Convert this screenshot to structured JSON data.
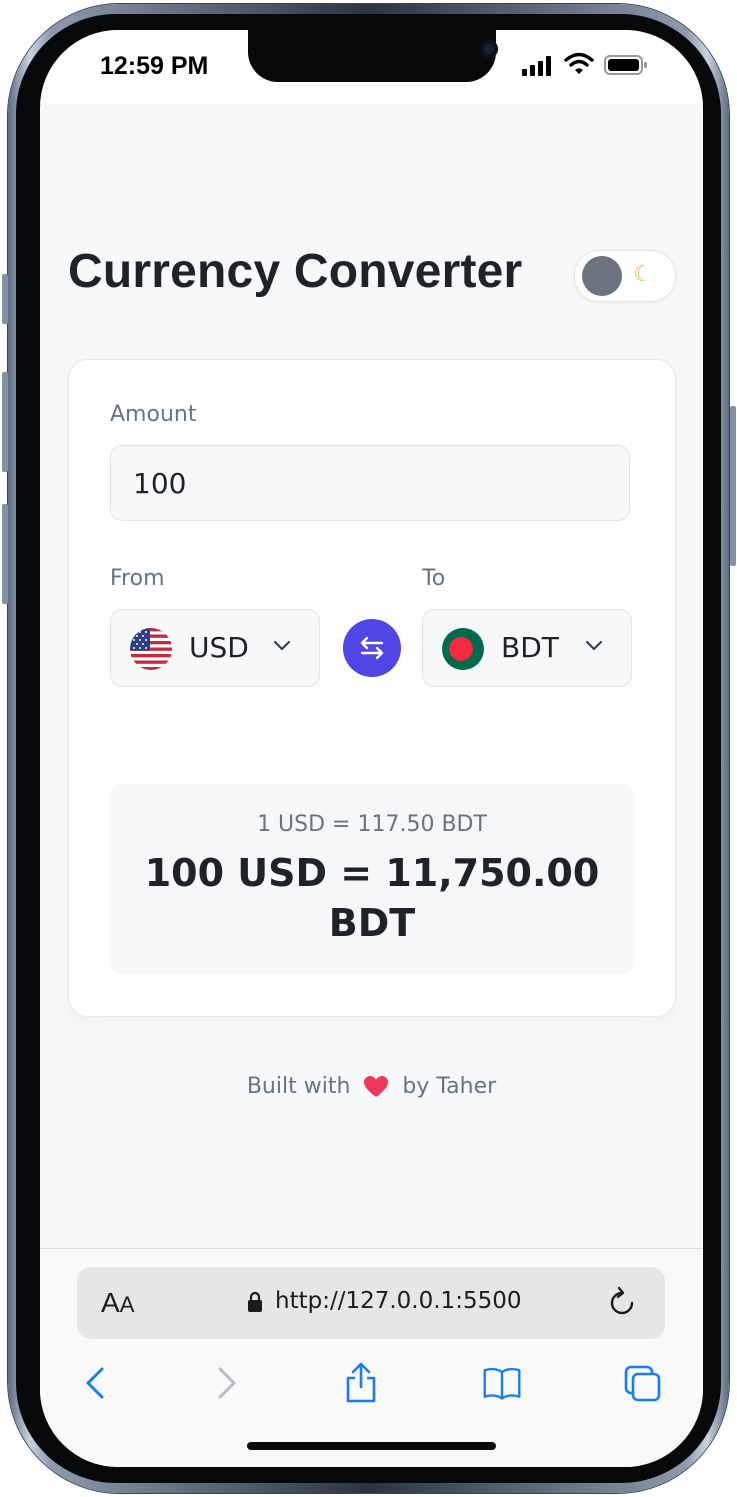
{
  "status_bar": {
    "time": "12:59 PM"
  },
  "page": {
    "title": "Currency Converter",
    "theme_toggle": {
      "icon": "moon-icon",
      "state": "off"
    }
  },
  "converter": {
    "amount_label": "Amount",
    "amount_value": "100",
    "from_label": "From",
    "to_label": "To",
    "from_currency": {
      "code": "USD",
      "flag_icon": "us-flag-icon"
    },
    "to_currency": {
      "code": "BDT",
      "flag_icon": "bangladesh-flag-icon"
    },
    "swap_icon": "swap-arrows-icon",
    "rate_text": "1 USD = 117.50 BDT",
    "result_text": "100 USD = 11,750.00 BDT"
  },
  "footer": {
    "prefix": "Built with",
    "suffix": "by Taher",
    "icon": "heart-icon"
  },
  "browser": {
    "text_size_button": {
      "large": "A",
      "small": "A"
    },
    "url": "http://127.0.0.1:5500"
  },
  "colors": {
    "accent": "#4f46e5",
    "text": "#1f2328",
    "muted": "#6b7280",
    "browser_blue": "#1a7cf5"
  }
}
